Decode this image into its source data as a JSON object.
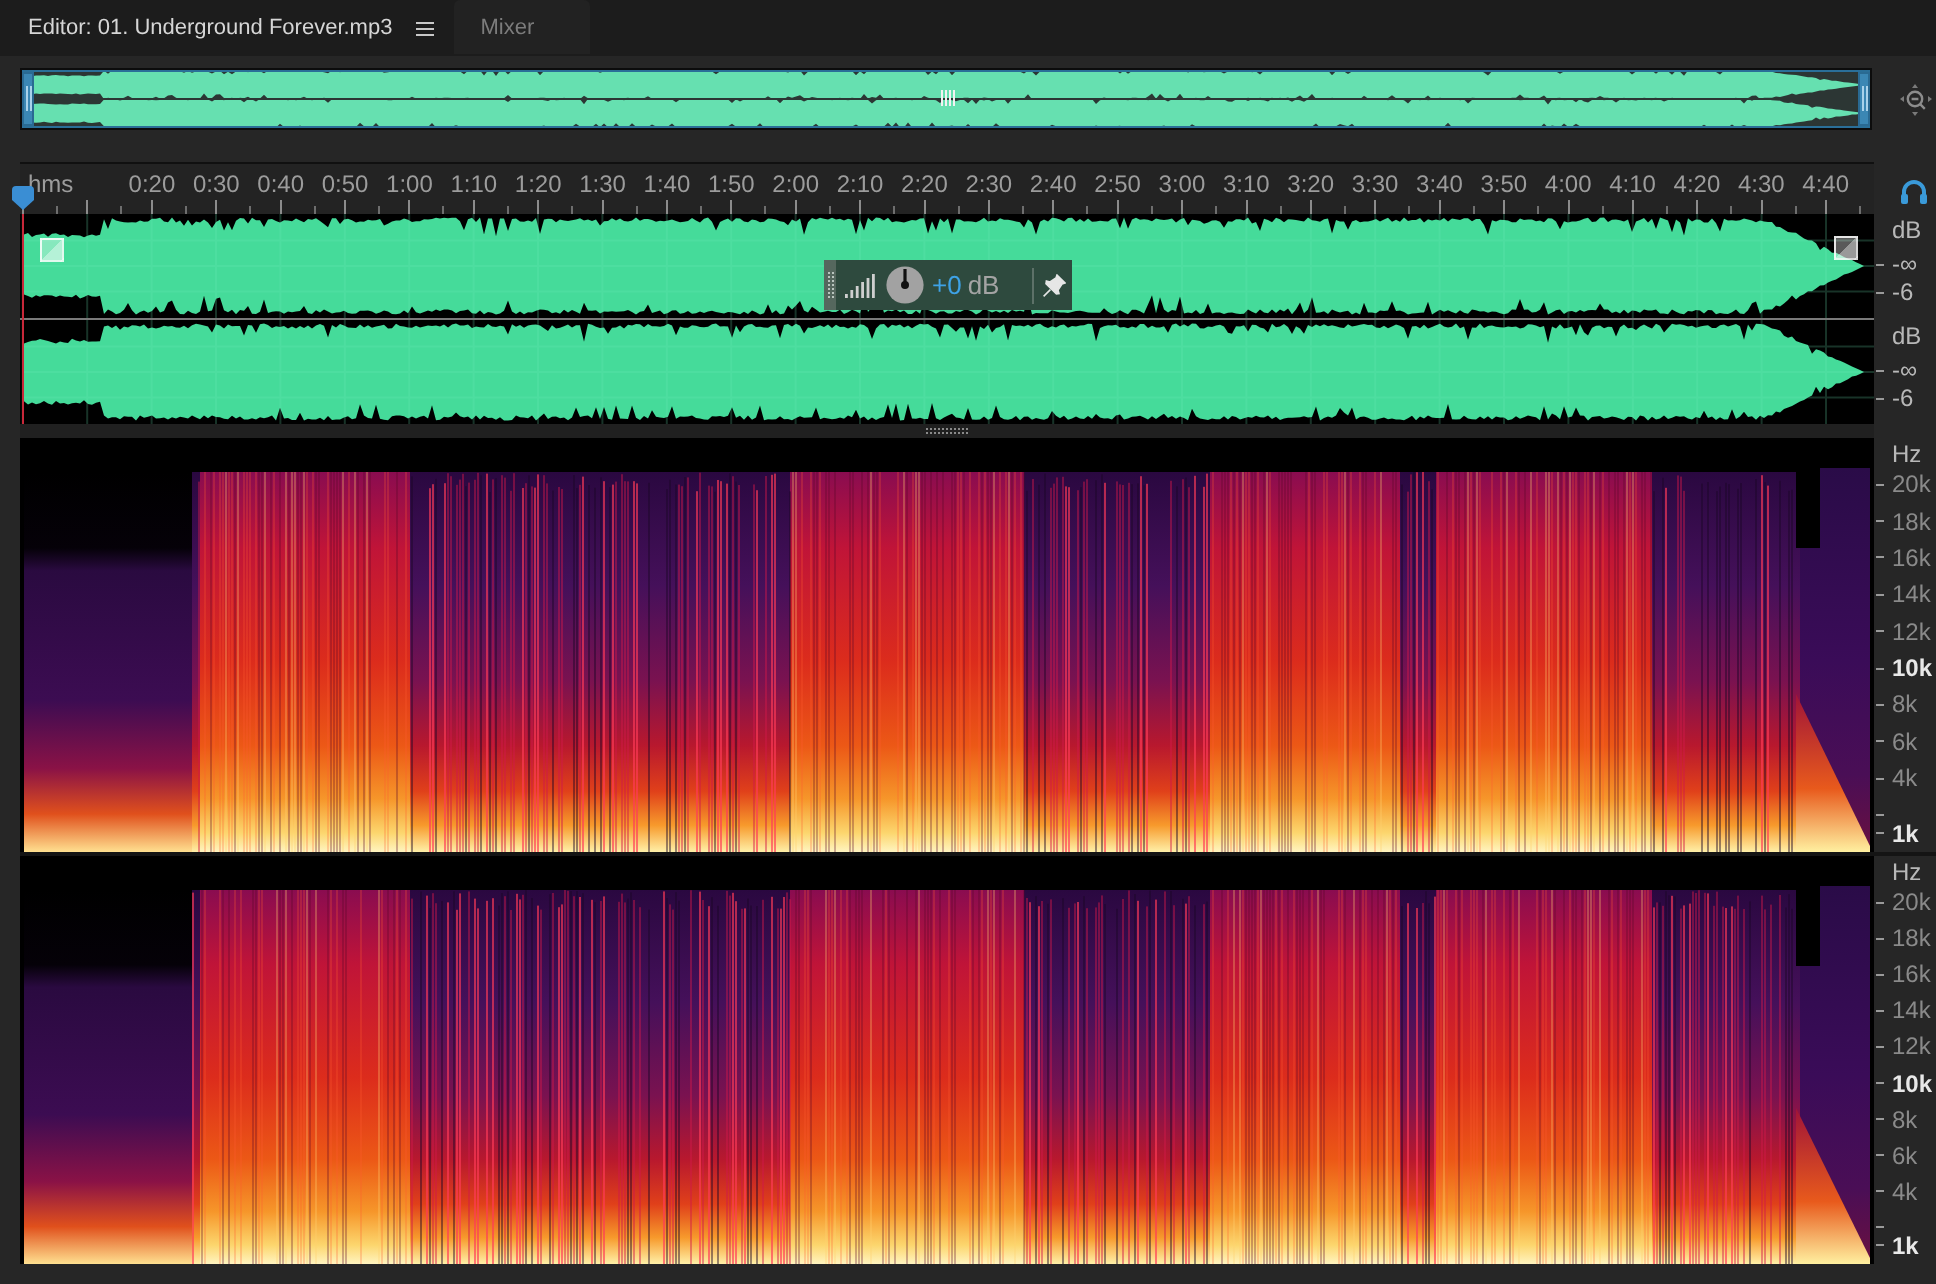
{
  "tabs": [
    {
      "label": "Editor: 01. Underground Forever.mp3",
      "selected": true
    },
    {
      "label": "Mixer",
      "selected": false
    }
  ],
  "timeline": {
    "format": "hms",
    "ticks": [
      "0:20",
      "0:30",
      "0:40",
      "0:50",
      "1:00",
      "1:10",
      "1:20",
      "1:30",
      "1:40",
      "1:50",
      "2:00",
      "2:10",
      "2:20",
      "2:30",
      "2:40",
      "2:50",
      "3:00",
      "3:10",
      "3:20",
      "3:30",
      "3:40",
      "3:50",
      "4:00",
      "4:10",
      "4:20",
      "4:30",
      "4:40"
    ]
  },
  "waveform": {
    "channels": [
      {
        "unit": "dB",
        "scale": [
          "-∞",
          "-6"
        ]
      },
      {
        "unit": "dB",
        "scale": [
          "-∞",
          "-6"
        ]
      }
    ],
    "hud": {
      "value": "+0",
      "unit": "dB"
    }
  },
  "spectral": {
    "channels": [
      {
        "unit": "Hz",
        "scale": [
          {
            "label": "20k",
            "major": false
          },
          {
            "label": "18k",
            "major": false
          },
          {
            "label": "16k",
            "major": false
          },
          {
            "label": "14k",
            "major": false
          },
          {
            "label": "12k",
            "major": false
          },
          {
            "label": "10k",
            "major": true
          },
          {
            "label": "8k",
            "major": false
          },
          {
            "label": "6k",
            "major": false
          },
          {
            "label": "4k",
            "major": false
          },
          {
            "label": "1k",
            "major": true
          }
        ]
      },
      {
        "unit": "Hz",
        "scale": [
          {
            "label": "20k",
            "major": false
          },
          {
            "label": "18k",
            "major": false
          },
          {
            "label": "16k",
            "major": false
          },
          {
            "label": "14k",
            "major": false
          },
          {
            "label": "12k",
            "major": false
          },
          {
            "label": "10k",
            "major": true
          },
          {
            "label": "8k",
            "major": false
          },
          {
            "label": "6k",
            "major": false
          },
          {
            "label": "4k",
            "major": false
          },
          {
            "label": "1k",
            "major": true
          }
        ]
      }
    ]
  }
}
